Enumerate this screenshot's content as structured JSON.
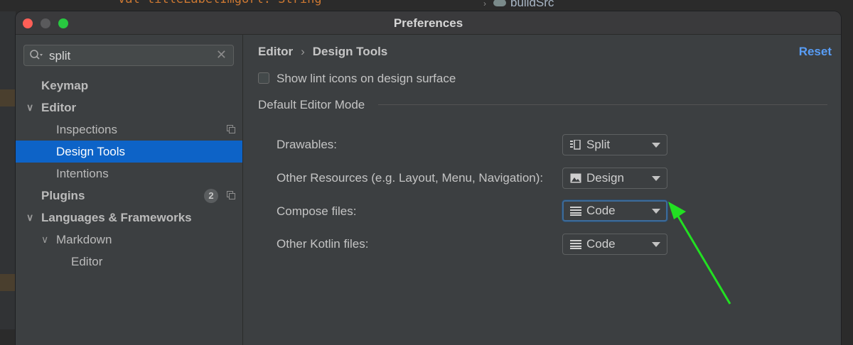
{
  "background": {
    "code_snippet": "val titleLabelImgUrl: String",
    "project_tree_item": "buildSrc"
  },
  "window": {
    "title": "Preferences"
  },
  "search": {
    "value": "split",
    "clear_glyph": "✕"
  },
  "tree": [
    {
      "label": "Keymap",
      "level": 0,
      "bold": true,
      "expandable": false
    },
    {
      "label": "Editor",
      "level": 0,
      "bold": true,
      "expandable": true,
      "expanded": true
    },
    {
      "label": "Inspections",
      "level": 1,
      "copy_icon": true
    },
    {
      "label": "Design Tools",
      "level": 1,
      "selected": true
    },
    {
      "label": "Intentions",
      "level": 1
    },
    {
      "label": "Plugins",
      "level": 0,
      "bold": true,
      "badge": "2",
      "copy_icon": true
    },
    {
      "label": "Languages & Frameworks",
      "level": 0,
      "bold": true,
      "expandable": true,
      "expanded": true
    },
    {
      "label": "Markdown",
      "level": 1,
      "expandable": true,
      "expanded": true
    },
    {
      "label": "Editor",
      "level": 2
    }
  ],
  "breadcrumb": {
    "parent": "Editor",
    "separator": "›",
    "current": "Design Tools"
  },
  "reset_label": "Reset",
  "lint_checkbox": {
    "label": "Show lint icons on design surface",
    "checked": false
  },
  "section_title": "Default Editor Mode",
  "options": [
    {
      "label": "Drawables:",
      "value": "Split",
      "icon": "split-icon"
    },
    {
      "label": "Other Resources (e.g. Layout, Menu, Navigation):",
      "value": "Design",
      "icon": "image-icon"
    },
    {
      "label": "Compose files:",
      "value": "Code",
      "icon": "code-lines-icon",
      "focused": true
    },
    {
      "label": "Other Kotlin files:",
      "value": "Code",
      "icon": "code-lines-icon"
    }
  ],
  "colors": {
    "selection": "#0d63c7",
    "link": "#589df6",
    "annotation_arrow": "#22e022",
    "focus_ring": "#3d6b99"
  }
}
